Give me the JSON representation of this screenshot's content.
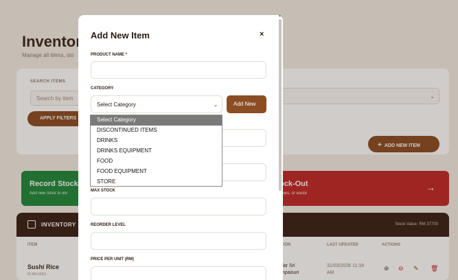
{
  "page": {
    "title": "Inventory",
    "subtitle": "Manage all items, sto",
    "search_label": "SEARCH ITEMS",
    "search_placeholder": "Search by item",
    "apply_filters": "APPLY FILTERS",
    "add_new_item": "ADD NEW ITEM",
    "record_stock_title": "Record Stock",
    "record_stock_sub": "Add new stock to inv",
    "stockout_title": "ock-Out",
    "stockout_sub": "sales, or waste",
    "inventory_title": "INVENTORY",
    "stock_value": "Stock Value: RM 37700",
    "table": {
      "headers": [
        "ITEM",
        "TION",
        "LAST UPDATED",
        "ACTIONS"
      ],
      "row": {
        "item": "Sushi Rice",
        "item_id": "ID-INV-0001",
        "location_1": "dar Sri",
        "location_2": "mpaisuri",
        "updated_1": "31/03/2026 11:18",
        "updated_2": "AM"
      }
    }
  },
  "modal": {
    "title": "Add New Item",
    "close": "×",
    "product_name_label": "PRODUCT NAME *",
    "category_label": "CATEGORY",
    "category_value": "Select Category",
    "add_new": "Add New",
    "max_stock_label": "MAX STOCK",
    "reorder_level_label": "REORDER LEVEL",
    "price_label": "PRICE PER UNIT (RM)"
  },
  "dropdown": {
    "options": [
      "Select Category",
      "DISCONTINUED ITEMS",
      "DRINKS",
      "DRINKS EQUIPMENT",
      "FOOD",
      "FOOD EQUIPMENT",
      "STORE"
    ],
    "selected_index": 0
  },
  "colors": {
    "accent": "#8b4d24",
    "green": "#1f8a3b",
    "red": "#c02a2a",
    "dark": "#3a2218"
  }
}
